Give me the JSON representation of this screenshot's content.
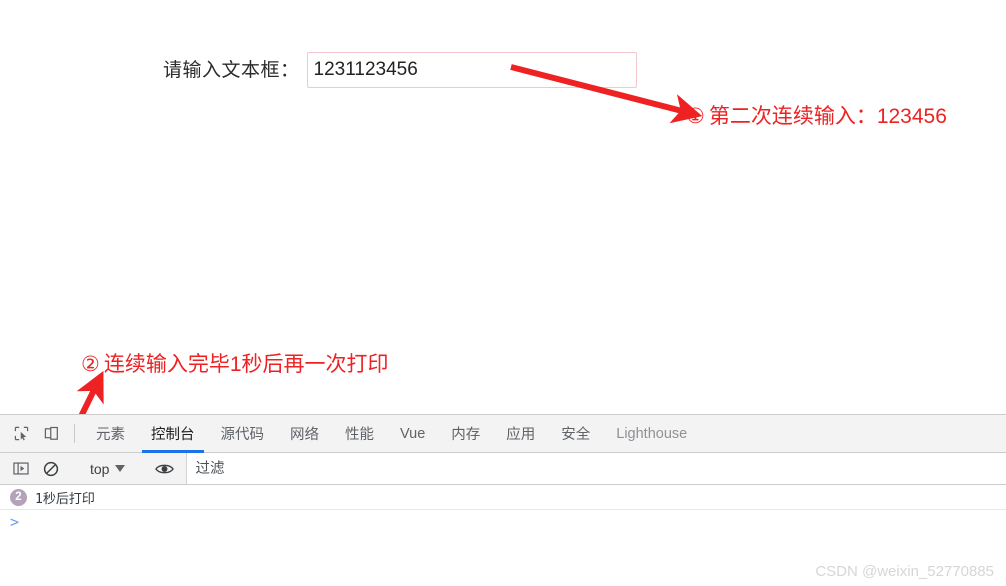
{
  "page": {
    "form": {
      "label": "请输入文本框：",
      "input_value": "1231123456",
      "input_placeholder": ""
    },
    "annotations": [
      {
        "marker": "①",
        "text": "第二次连续输入：123456",
        "color": "#ee2222"
      },
      {
        "marker": "②",
        "text": "连续输入完毕1秒后再一次打印",
        "color": "#ee2222"
      }
    ]
  },
  "devtools": {
    "tabs": [
      {
        "label": "元素",
        "active": false,
        "muted": false
      },
      {
        "label": "控制台",
        "active": true,
        "muted": false
      },
      {
        "label": "源代码",
        "active": false,
        "muted": false
      },
      {
        "label": "网络",
        "active": false,
        "muted": false
      },
      {
        "label": "性能",
        "active": false,
        "muted": false
      },
      {
        "label": "Vue",
        "active": false,
        "muted": false
      },
      {
        "label": "内存",
        "active": false,
        "muted": false
      },
      {
        "label": "应用",
        "active": false,
        "muted": false
      },
      {
        "label": "安全",
        "active": false,
        "muted": false
      },
      {
        "label": "Lighthouse",
        "active": false,
        "muted": true
      }
    ],
    "toolbar_icons": [
      {
        "name": "inspect-element-icon"
      },
      {
        "name": "device-toolbar-icon"
      }
    ],
    "console_toolbar": {
      "sidebar_toggle": "console-sidebar-icon",
      "clear_label": "clear-console-icon",
      "context": "top",
      "eye_icon": "live-expression-eye-icon",
      "filter_placeholder": "过滤",
      "filter_value": ""
    },
    "console_messages": [
      {
        "count": "2",
        "text": "1秒后打印"
      }
    ],
    "prompt": ">"
  },
  "watermark": "CSDN @weixin_52770885",
  "colors": {
    "accent_blue": "#1a73e8",
    "annotation_red": "#ee2222",
    "input_border": "#f3c6cd",
    "badge": "#b3a2b8"
  }
}
